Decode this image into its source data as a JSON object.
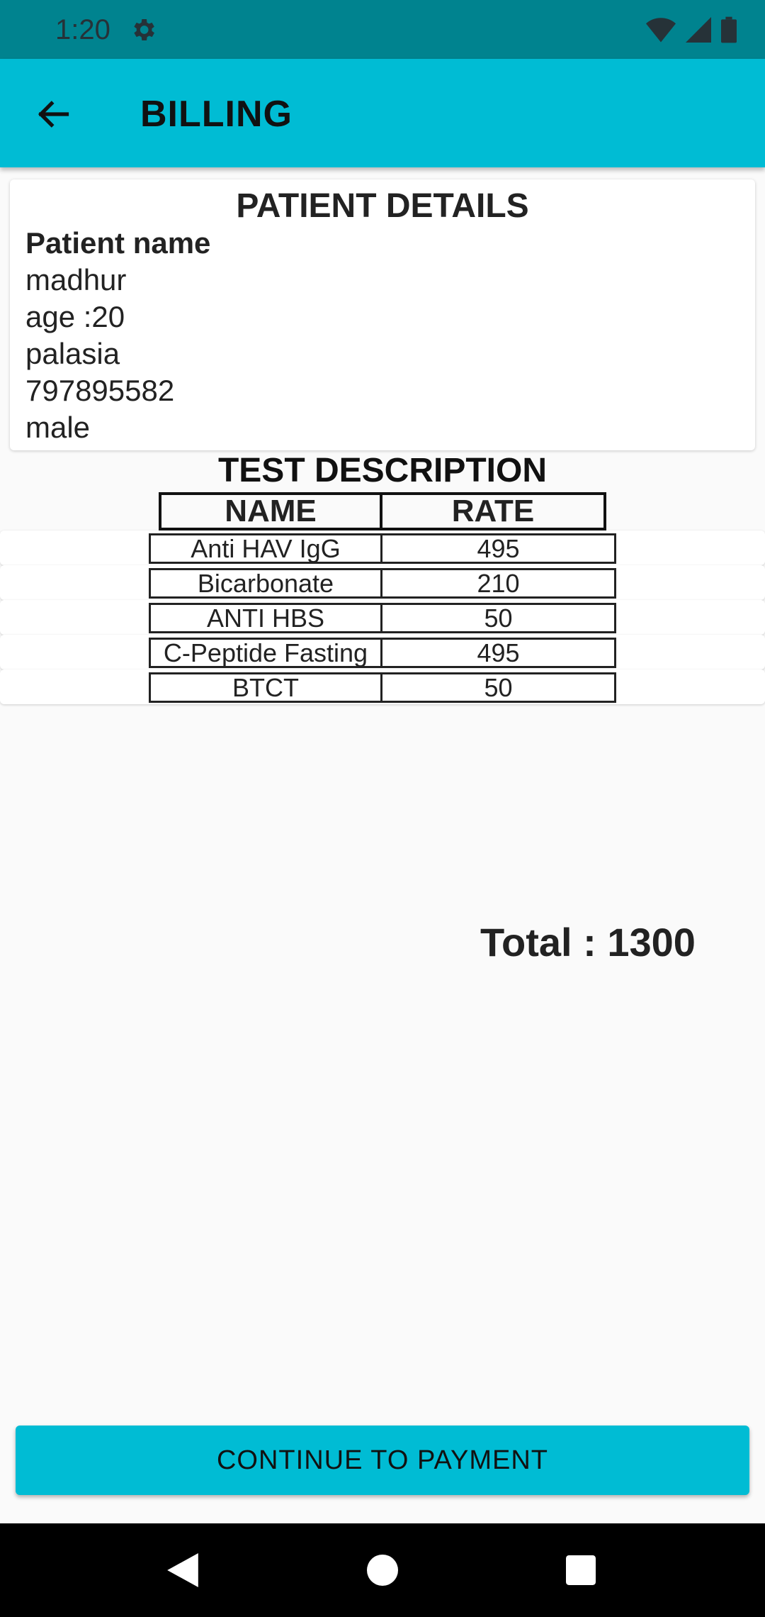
{
  "status_bar": {
    "time": "1:20",
    "icons": [
      "gear-icon",
      "wifi-icon",
      "signal-icon",
      "battery-icon"
    ]
  },
  "app_bar": {
    "title": "BILLING",
    "back_icon": "arrow-left-icon",
    "color": "#00bcd4"
  },
  "patient": {
    "heading": "PATIENT DETAILS",
    "label": "Patient name",
    "name": "madhur",
    "age": "age :20",
    "address": "palasia",
    "phone": "797895582",
    "gender": "male"
  },
  "tests": {
    "heading": "TEST DESCRIPTION",
    "columns": [
      "NAME",
      "RATE"
    ],
    "rows": [
      {
        "name": "Anti HAV IgG",
        "rate": "495"
      },
      {
        "name": "Bicarbonate",
        "rate": "210"
      },
      {
        "name": "ANTI HBS",
        "rate": "50"
      },
      {
        "name": "C-Peptide Fasting",
        "rate": "495"
      },
      {
        "name": "BTCT",
        "rate": "50"
      }
    ]
  },
  "total": "Total : 1300",
  "payment_button": "CONTINUE TO PAYMENT",
  "nav": [
    "back-triangle-icon",
    "home-circle-icon",
    "recents-square-icon"
  ]
}
